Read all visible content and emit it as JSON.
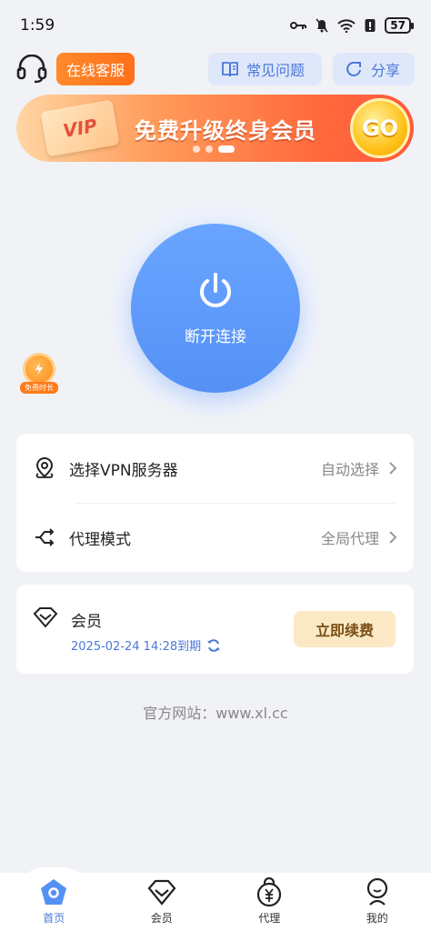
{
  "status": {
    "time": "1:59",
    "battery": "57"
  },
  "header": {
    "customer_service": "在线客服",
    "faq": "常见问题",
    "share": "分享"
  },
  "banner": {
    "card_text": "VIP",
    "headline": "免费升级终身会员",
    "go": "GO"
  },
  "power": {
    "label": "断开连接",
    "state": "connected"
  },
  "free_time": {
    "label": "免费时长"
  },
  "settings": {
    "server": {
      "label": "选择VPN服务器",
      "value": "自动选择"
    },
    "proxy": {
      "label": "代理模式",
      "value": "全局代理"
    }
  },
  "member": {
    "title": "会员",
    "expiry": "2025-02-24 14:28到期",
    "renew": "立即续费"
  },
  "footer": {
    "website": "官方网站：www.xl.cc"
  },
  "tabs": [
    {
      "label": "首页",
      "icon": "home-icon",
      "active": true
    },
    {
      "label": "会员",
      "icon": "diamond-icon",
      "active": false
    },
    {
      "label": "代理",
      "icon": "proxy-icon",
      "active": false
    },
    {
      "label": "我的",
      "icon": "profile-icon",
      "active": false
    }
  ],
  "colors": {
    "accent": "#5591f5",
    "orange": "#ff6f1a",
    "link": "#4a78d8",
    "renew_bg": "#fbe9c6"
  }
}
